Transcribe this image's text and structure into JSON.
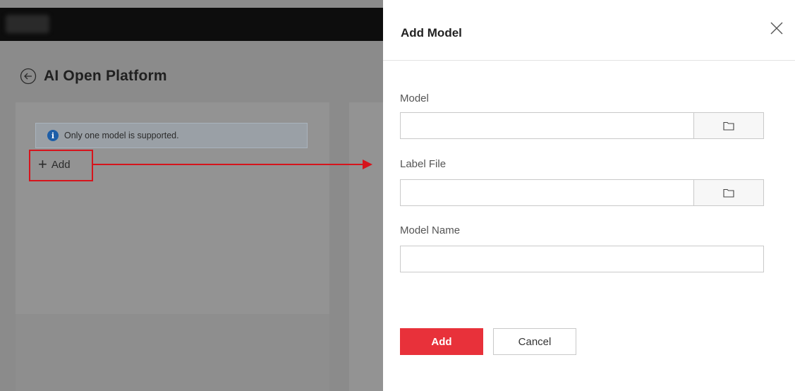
{
  "background": {
    "page_title": "AI Open Platform",
    "info_message": "Only one model is supported.",
    "add_label": "Add"
  },
  "dialog": {
    "title": "Add Model",
    "fields": {
      "model": {
        "label": "Model",
        "value": ""
      },
      "label_file": {
        "label": "Label File",
        "value": ""
      },
      "model_name": {
        "label": "Model Name",
        "value": ""
      }
    },
    "buttons": {
      "add": "Add",
      "cancel": "Cancel"
    }
  },
  "icons": {
    "back": "back-arrow-circle-icon",
    "info": "info-icon",
    "plus": "plus-icon",
    "close": "close-icon",
    "folder": "folder-icon"
  },
  "colors": {
    "accent": "#e8313a",
    "highlight": "#d6141c",
    "info": "#1d5ea8"
  }
}
